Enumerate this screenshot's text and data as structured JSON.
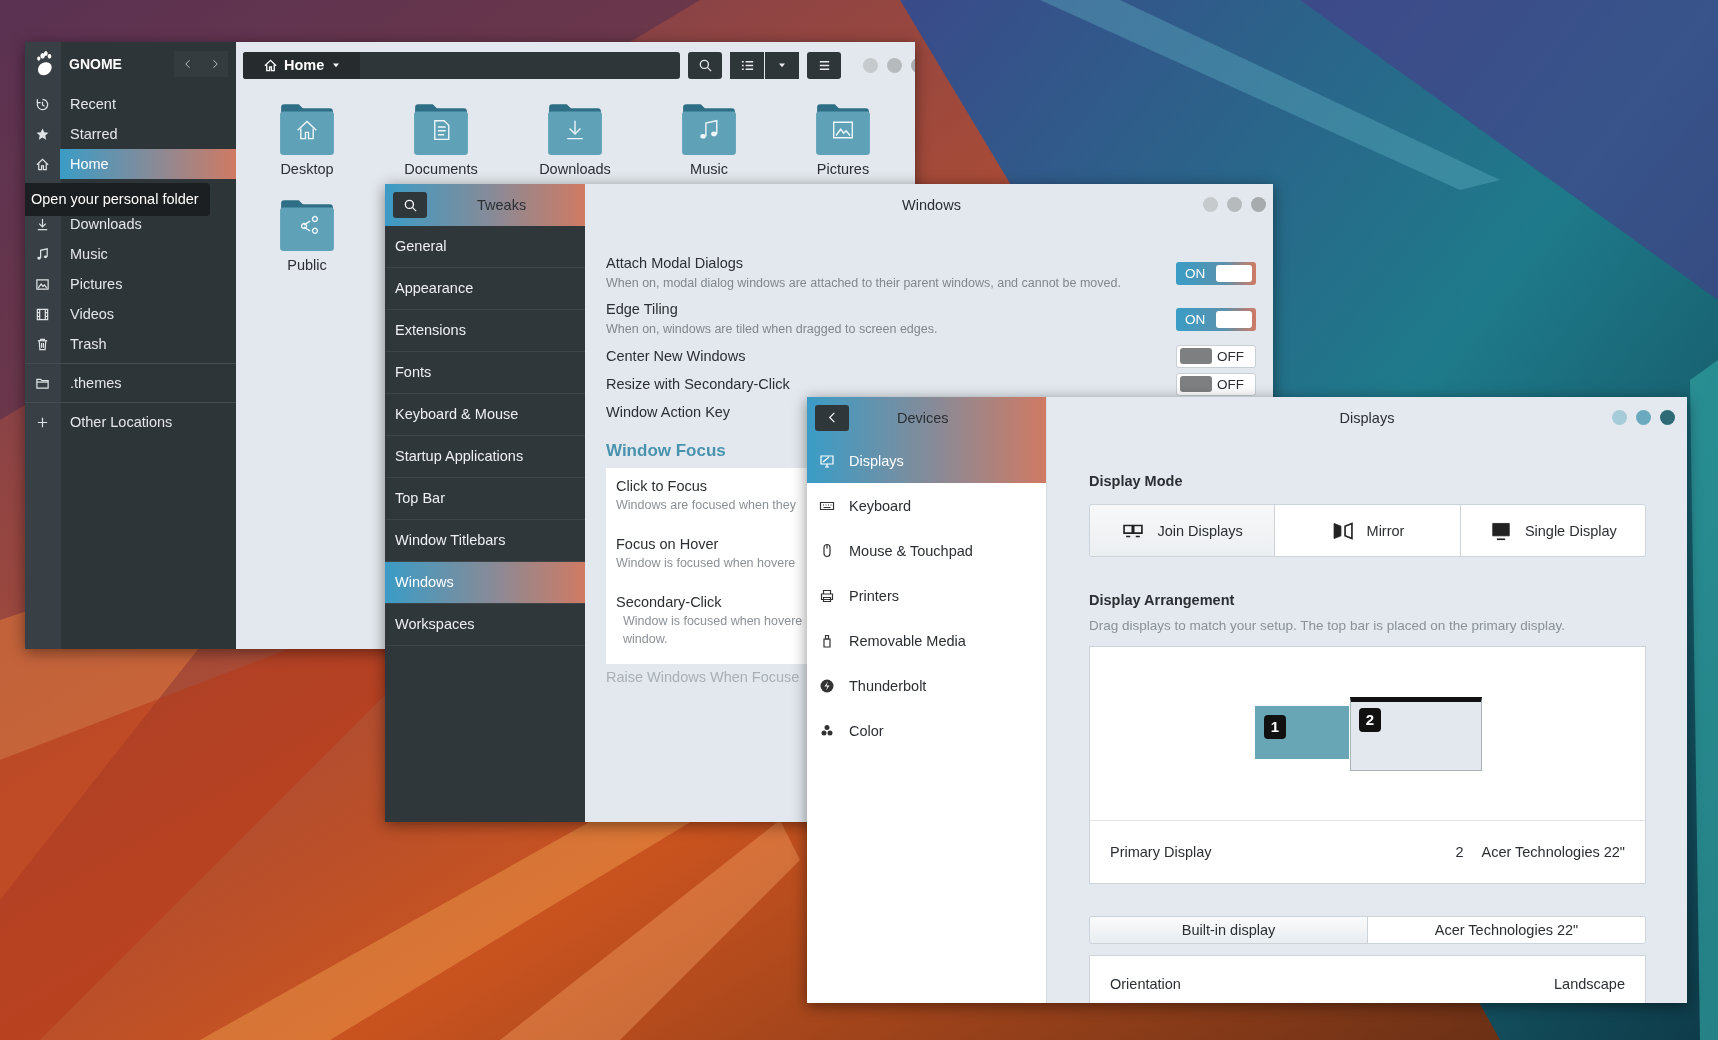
{
  "files": {
    "app_name": "GNOME",
    "location": "Home",
    "places": [
      [
        {
          "label": "Recent",
          "selected": false
        },
        {
          "label": "Starred",
          "selected": false
        },
        {
          "label": "Home",
          "selected": true,
          "tooltip": "Open your personal folder"
        },
        {
          "label": "Downloads",
          "selected": false
        },
        {
          "label": "Music",
          "selected": false
        },
        {
          "label": "Pictures",
          "selected": false
        },
        {
          "label": "Videos",
          "selected": false
        },
        {
          "label": "Trash",
          "selected": false
        }
      ],
      [
        {
          "label": ".themes",
          "selected": false
        }
      ],
      [
        {
          "label": "Other Locations",
          "selected": false
        }
      ]
    ],
    "folders": [
      "Desktop",
      "Documents",
      "Downloads",
      "Music",
      "Pictures",
      "Public"
    ]
  },
  "tweaks": {
    "app_name": "Tweaks",
    "title": "Windows",
    "categories": [
      {
        "label": "General",
        "selected": false
      },
      {
        "label": "Appearance",
        "selected": false
      },
      {
        "label": "Extensions",
        "selected": false
      },
      {
        "label": "Fonts",
        "selected": false
      },
      {
        "label": "Keyboard & Mouse",
        "selected": false
      },
      {
        "label": "Startup Applications",
        "selected": false
      },
      {
        "label": "Top Bar",
        "selected": false
      },
      {
        "label": "Window Titlebars",
        "selected": false
      },
      {
        "label": "Windows",
        "selected": true
      },
      {
        "label": "Workspaces",
        "selected": false
      }
    ],
    "settings": [
      {
        "title": "Attach Modal Dialogs",
        "subtitle": "When on, modal dialog windows are attached to their parent windows, and cannot be moved.",
        "on": true,
        "switch_text": "ON"
      },
      {
        "title": "Edge Tiling",
        "subtitle": "When on, windows are tiled when dragged to screen edges.",
        "on": true,
        "switch_text": "ON"
      },
      {
        "title": "Center New Windows",
        "on": false,
        "switch_text": "OFF"
      },
      {
        "title": "Resize with Secondary-Click",
        "on": false,
        "switch_text": "OFF"
      },
      {
        "title": "Window Action Key"
      }
    ],
    "focus_heading": "Window Focus",
    "focus_options": [
      {
        "title": "Click to Focus",
        "subtitle_lines": [
          "Windows are focused when they"
        ]
      },
      {
        "title": "Focus on Hover",
        "subtitle_lines": [
          "Window is focused when hovere"
        ]
      },
      {
        "title": "Secondary-Click",
        "subtitle_lines": [
          "Window is focused when hovere",
          "window."
        ]
      }
    ],
    "raise_label": "Raise Windows When Focuse"
  },
  "settings": {
    "panel": "Devices",
    "title": "Displays",
    "devices": [
      {
        "label": "Displays",
        "selected": true
      },
      {
        "label": "Keyboard",
        "selected": false
      },
      {
        "label": "Mouse & Touchpad",
        "selected": false
      },
      {
        "label": "Printers",
        "selected": false
      },
      {
        "label": "Removable Media",
        "selected": false
      },
      {
        "label": "Thunderbolt",
        "selected": false
      },
      {
        "label": "Color",
        "selected": false
      }
    ],
    "display_mode": {
      "heading": "Display Mode",
      "options": [
        {
          "label": "Join Displays",
          "selected": true
        },
        {
          "label": "Mirror",
          "selected": false
        },
        {
          "label": "Single Display",
          "selected": false
        }
      ]
    },
    "arrangement": {
      "heading": "Display Arrangement",
      "description": "Drag displays to match your setup. The top bar is placed on the primary display.",
      "monitors": [
        {
          "label": "1",
          "selected": true,
          "primary": false
        },
        {
          "label": "2",
          "selected": false,
          "primary": true
        }
      ],
      "primary_label": "Primary Display",
      "primary_number": "2",
      "primary_name": "Acer Technologies 22\""
    },
    "display_tabs": [
      {
        "label": "Built-in display",
        "selected": true
      },
      {
        "label": "Acer Technologies 22\"",
        "selected": false
      }
    ],
    "orientation": {
      "label": "Orientation",
      "value": "Landscape"
    }
  }
}
